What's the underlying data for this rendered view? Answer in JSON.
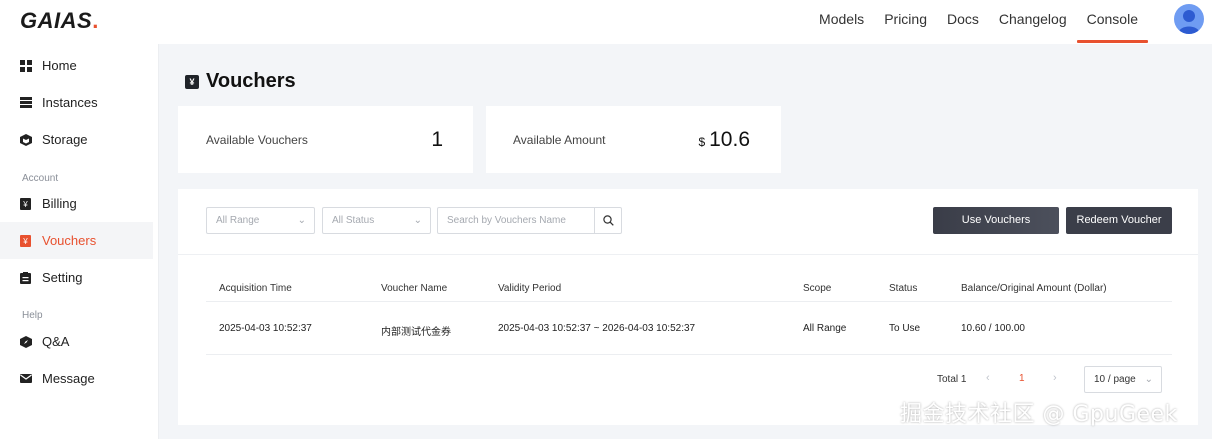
{
  "brand": {
    "name": "GAIAS",
    "dot": ".",
    "accent": "#e8512f"
  },
  "topnav": [
    {
      "label": "Models"
    },
    {
      "label": "Pricing"
    },
    {
      "label": "Docs"
    },
    {
      "label": "Changelog"
    },
    {
      "label": "Console",
      "active": true
    }
  ],
  "sidebar": {
    "items": [
      {
        "label": "Home",
        "icon": "grid-icon"
      },
      {
        "label": "Instances",
        "icon": "server-icon"
      },
      {
        "label": "Storage",
        "icon": "cube-icon"
      },
      {
        "label": "Billing",
        "icon": "yen-icon"
      },
      {
        "label": "Vouchers",
        "icon": "yen-icon",
        "active": true
      },
      {
        "label": "Setting",
        "icon": "clipboard-icon"
      },
      {
        "label": "Q&A",
        "icon": "compass-icon"
      },
      {
        "label": "Message",
        "icon": "mail-icon"
      }
    ],
    "sections": {
      "account": "Account",
      "help": "Help"
    }
  },
  "page": {
    "title": "Vouchers",
    "title_icon": "¥"
  },
  "stats": {
    "available_vouchers": {
      "label": "Available Vouchers",
      "value": "1"
    },
    "available_amount": {
      "label": "Available Amount",
      "currency": "$",
      "value": "10.6"
    }
  },
  "filters": {
    "range": "All Range",
    "status": "All Status",
    "search_placeholder": "Search by Vouchers Name"
  },
  "actions": {
    "use": "Use Vouchers",
    "redeem": "Redeem Voucher"
  },
  "table": {
    "headers": [
      "Acquisition Time",
      "Voucher Name",
      "Validity Period",
      "Scope",
      "Status",
      "Balance/Original Amount (Dollar)"
    ],
    "rows": [
      [
        "2025-04-03 10:52:37",
        "内部测试代金券",
        "2025-04-03 10:52:37 ~ 2026-04-03 10:52:37",
        "All Range",
        "To Use",
        "10.60 / 100.00"
      ]
    ]
  },
  "pagination": {
    "total": "Total 1",
    "prev": "‹",
    "page": "1",
    "next": "›",
    "page_size": "10 / page"
  },
  "watermark": "掘金技术社区 @ GpuGeek"
}
